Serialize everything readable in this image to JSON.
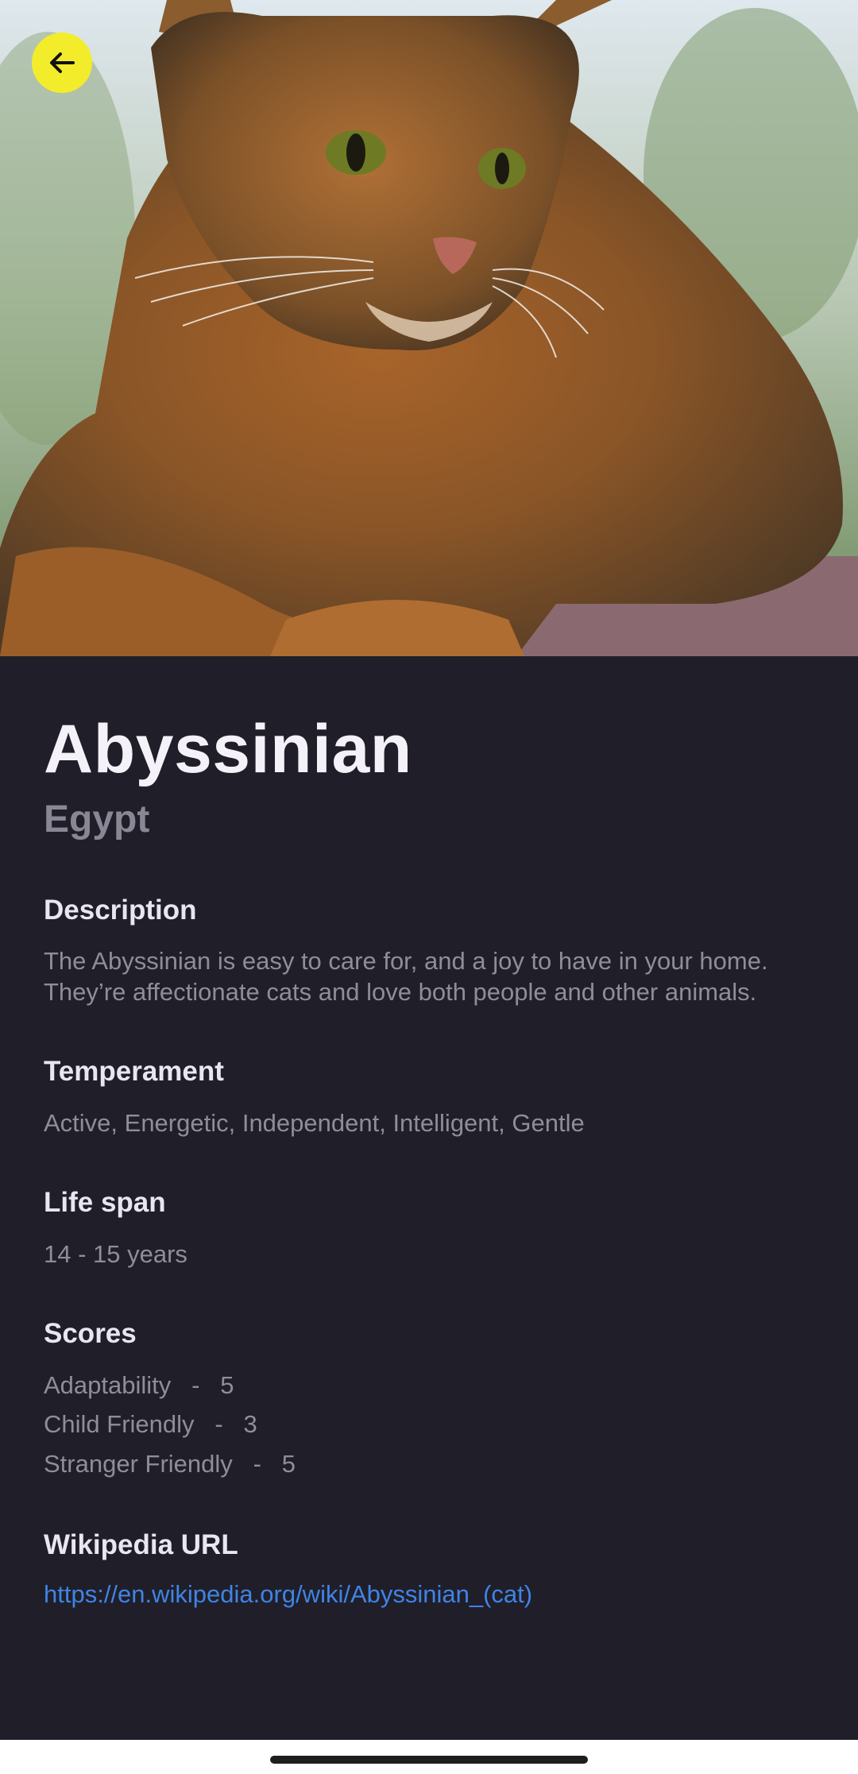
{
  "hero": {
    "image_description": "cat-photo",
    "back_icon": "arrow-left-icon"
  },
  "breed": {
    "name": "Abyssinian",
    "origin": "Egypt"
  },
  "description": {
    "title": "Description",
    "text_line1": "The Abyssinian is easy to care for, and a joy to have in your home.",
    "text_line2": "They’re affectionate cats and love both people and other animals."
  },
  "temperament": {
    "title": "Temperament",
    "text": "Active, Energetic, Independent, Intelligent, Gentle"
  },
  "life_span": {
    "title": "Life span",
    "text": "14 - 15 years"
  },
  "scores": {
    "title": "Scores",
    "items": [
      {
        "label": "Adaptability   -   5"
      },
      {
        "label": "Child Friendly   -   3"
      },
      {
        "label": "Stranger Friendly   -   5"
      }
    ]
  },
  "wikipedia": {
    "title": "Wikipedia URL",
    "url": "https://en.wikipedia.org/wiki/Abyssinian_(cat)"
  },
  "colors": {
    "accent": "#f3ec2b",
    "background": "#201e29",
    "link": "#3f84e5"
  }
}
